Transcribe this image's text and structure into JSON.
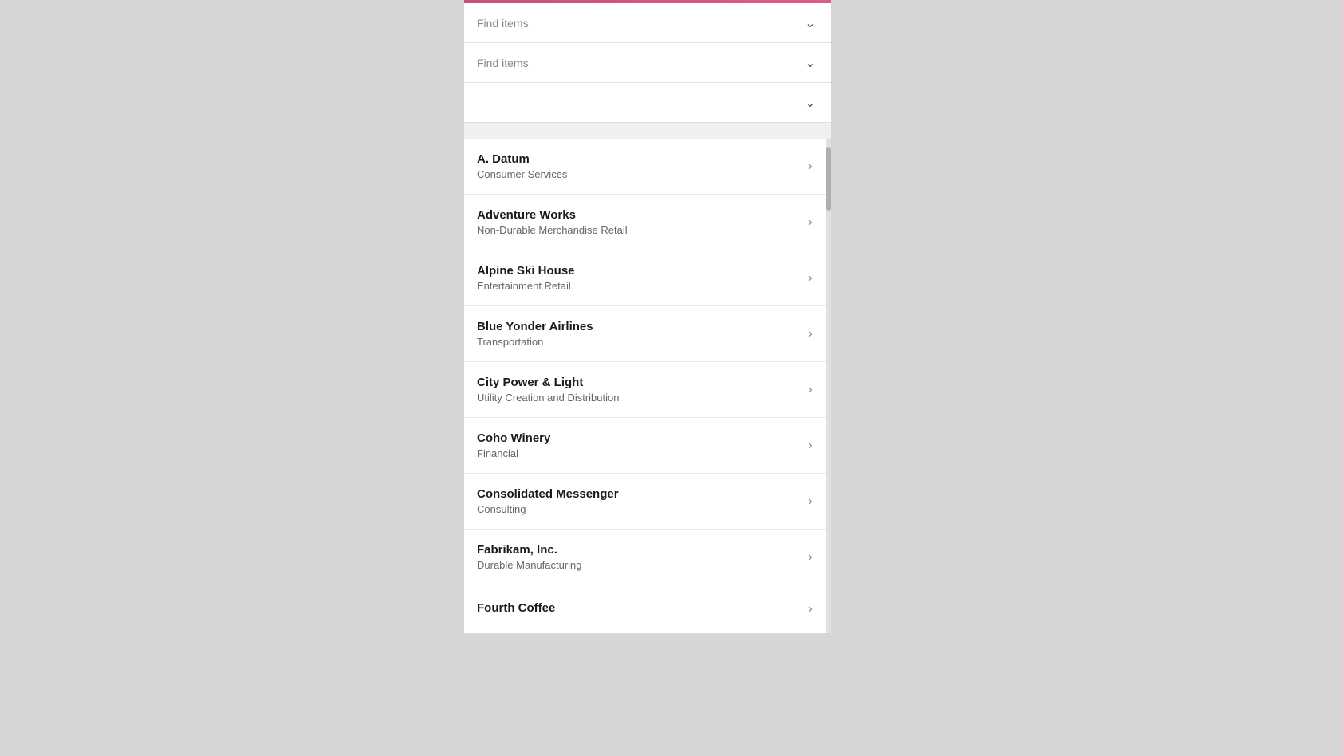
{
  "topBar": {
    "color": "#c94f7c"
  },
  "filters": [
    {
      "id": "filter1",
      "placeholder": "Find items",
      "hasText": true
    },
    {
      "id": "filter2",
      "placeholder": "Find items",
      "hasText": true
    },
    {
      "id": "filter3",
      "placeholder": "",
      "hasText": false
    }
  ],
  "listItems": [
    {
      "id": "a-datum",
      "title": "A. Datum",
      "subtitle": "Consumer Services"
    },
    {
      "id": "adventure-works",
      "title": "Adventure Works",
      "subtitle": "Non-Durable Merchandise Retail"
    },
    {
      "id": "alpine-ski-house",
      "title": "Alpine Ski House",
      "subtitle": "Entertainment Retail"
    },
    {
      "id": "blue-yonder-airlines",
      "title": "Blue Yonder Airlines",
      "subtitle": "Transportation"
    },
    {
      "id": "city-power-light",
      "title": "City Power & Light",
      "subtitle": "Utility Creation and Distribution"
    },
    {
      "id": "coho-winery",
      "title": "Coho Winery",
      "subtitle": "Financial"
    },
    {
      "id": "consolidated-messenger",
      "title": "Consolidated Messenger",
      "subtitle": "Consulting"
    },
    {
      "id": "fabrikam-inc",
      "title": "Fabrikam, Inc.",
      "subtitle": "Durable Manufacturing"
    },
    {
      "id": "fourth-coffee",
      "title": "Fourth Coffee",
      "subtitle": ""
    }
  ],
  "icons": {
    "chevronDown": "⌄",
    "chevronRight": "›"
  }
}
